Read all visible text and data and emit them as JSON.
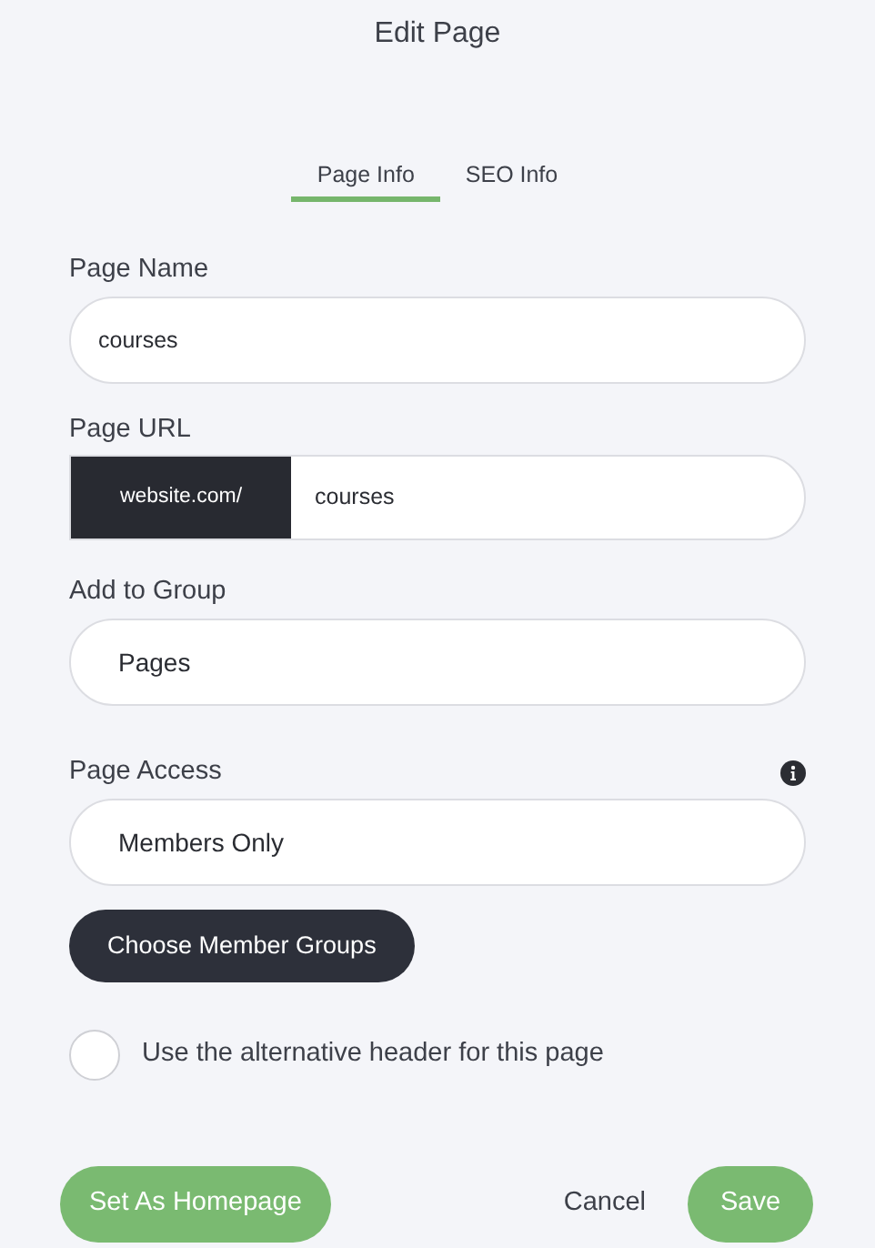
{
  "window": {
    "title": "Edit Page"
  },
  "tabs": [
    {
      "label": "Page Info",
      "selected": true
    },
    {
      "label": "SEO Info",
      "selected": false
    }
  ],
  "fields": [
    {
      "kind": "text",
      "label": "Page Name",
      "value": "courses"
    },
    {
      "kind": "url",
      "label": "Page URL",
      "prefix": "website.com/",
      "value": "courses"
    },
    {
      "kind": "select",
      "label": "Add to Group",
      "value": "Pages"
    },
    {
      "kind": "select",
      "label": "Page Access",
      "value": "Members Only",
      "info": true
    }
  ],
  "choose_button": "Choose Member Groups",
  "alt_header": {
    "label": "Use the alternative header for this page",
    "checked": false
  },
  "footer": {
    "homepage_button": "Set As Homepage",
    "cancel": "Cancel",
    "save": "Save"
  }
}
